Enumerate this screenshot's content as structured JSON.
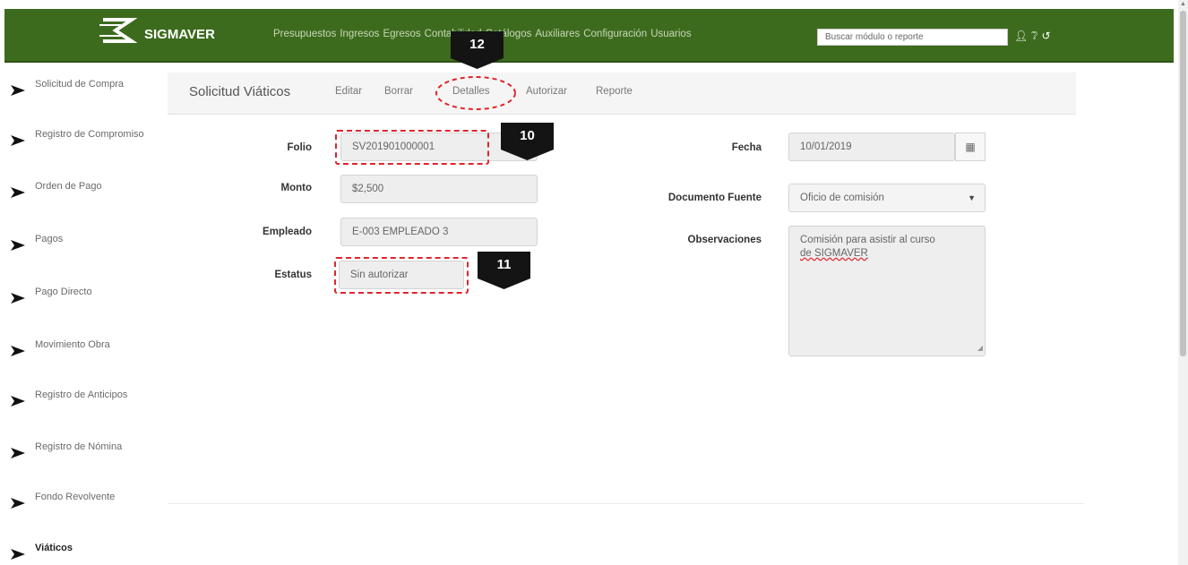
{
  "navbar": {
    "brand": "SIGMAVER",
    "menu": [
      "Presupuestos",
      "Ingresos",
      "Egresos",
      "Contabilidad",
      "Catálogos",
      "Auxiliares",
      "Configuración",
      "Usuarios"
    ],
    "search_placeholder": "Buscar módulo o reporte",
    "icons": [
      "user-icon",
      "help-icon",
      "logout-icon"
    ]
  },
  "sidebar": {
    "items": [
      {
        "label": "Solicitud de Compra"
      },
      {
        "label": "Registro de Compromiso"
      },
      {
        "label": "Orden de Pago"
      },
      {
        "label": "Pagos"
      },
      {
        "label": "Pago Directo"
      },
      {
        "label": "Movimiento Obra"
      },
      {
        "label": "Registro de Anticipos"
      },
      {
        "label": "Registro de Nómina"
      },
      {
        "label": "Fondo Revolvente"
      },
      {
        "label": "Viáticos"
      }
    ]
  },
  "tabs": {
    "title": "Solicitud Viáticos",
    "items": [
      "Editar",
      "Borrar",
      "Detalles",
      "Autorizar",
      "Reporte"
    ]
  },
  "form": {
    "folio_label": "Folio",
    "folio_value": "SV201901000001",
    "monto_label": "Monto",
    "monto_value": "$2,500",
    "empleado_label": "Empleado",
    "empleado_value": "E-003 EMPLEADO 3",
    "estatus_label": "Estatus",
    "estatus_value": "Sin autorizar",
    "fecha_label": "Fecha",
    "fecha_value": "10/01/2019",
    "documento_label": "Documento Fuente",
    "documento_value": "Oficio de comisión",
    "observaciones_label": "Observaciones",
    "observaciones_value_1": "Comisión para asistir al curso",
    "observaciones_value_2": "de SIGMAVER"
  },
  "callouts": [
    "12",
    "10",
    "11"
  ],
  "colors": {
    "navbar": "#3d6b1e",
    "callout": "#141414",
    "highlight": "#e0242b"
  }
}
